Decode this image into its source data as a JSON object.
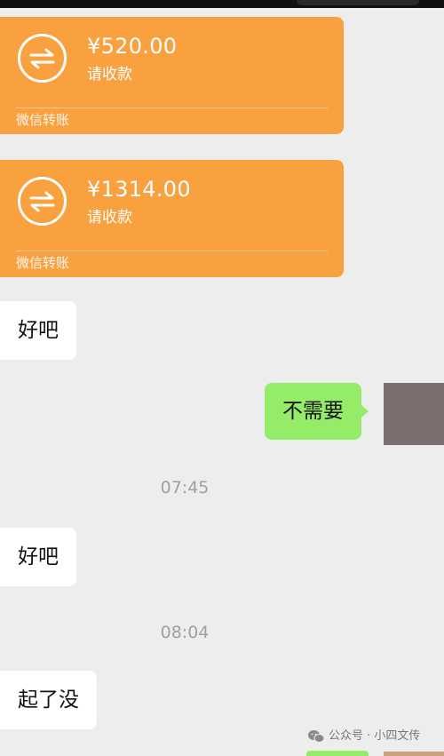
{
  "transfers": [
    {
      "amount": "¥520.00",
      "action": "请收款",
      "footer": "微信转账"
    },
    {
      "amount": "¥1314.00",
      "action": "请收款",
      "footer": "微信转账"
    }
  ],
  "messages": [
    {
      "side": "left",
      "text": "好吧"
    },
    {
      "side": "right",
      "text": "不需要"
    },
    {
      "type": "time",
      "text": "07:45"
    },
    {
      "side": "left",
      "text": "好吧"
    },
    {
      "type": "time",
      "text": "08:04"
    },
    {
      "side": "left",
      "text": "起了没"
    }
  ],
  "watermark": {
    "text": "公众号 · 小四文传"
  },
  "colors": {
    "background": "#ededed",
    "transfer_card": "#f9a03f",
    "incoming_bubble": "#ffffff",
    "outgoing_bubble": "#95ec69",
    "timestamp": "#a0a0a0"
  },
  "icons": {
    "transfer": "transfer-arrows-icon",
    "watermark": "wechat-icon"
  }
}
